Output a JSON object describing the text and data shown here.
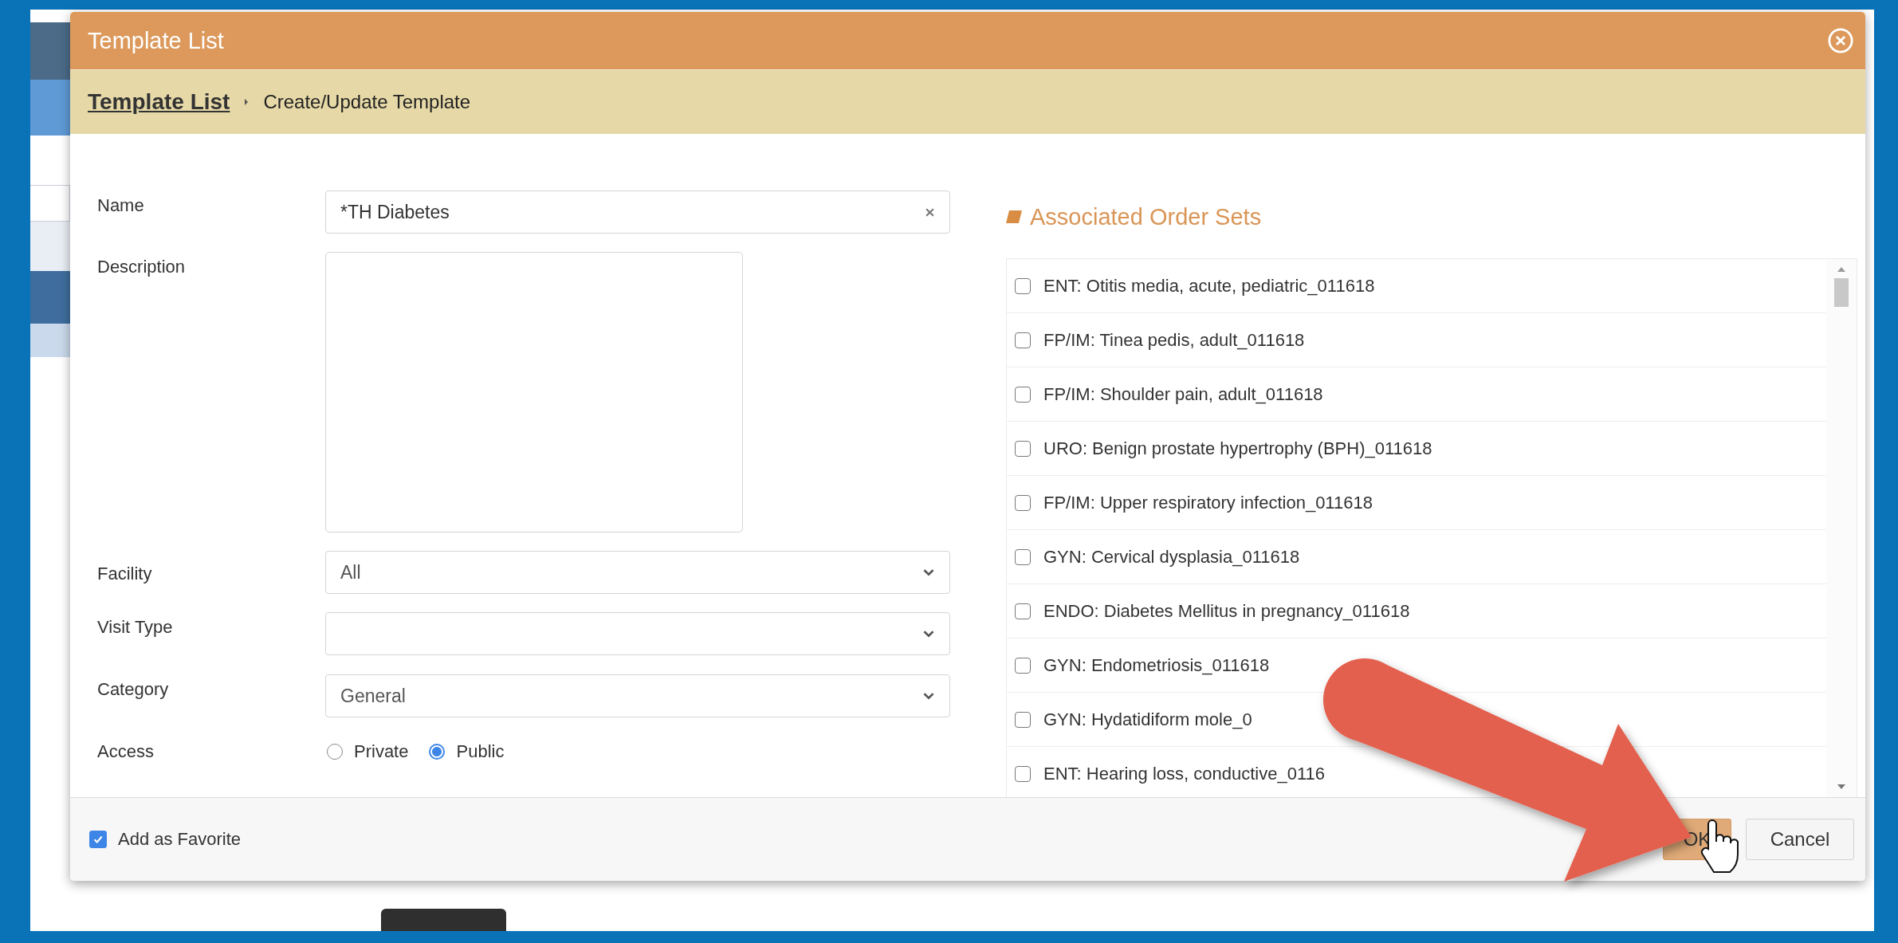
{
  "window": {
    "title": "Template List"
  },
  "breadcrumb": [
    {
      "label": "Template List",
      "kind": "link"
    },
    {
      "label": "Create/Update Template",
      "kind": "current"
    }
  ],
  "form": [
    {
      "kind": "text",
      "label": "Name",
      "value": "*TH Diabetes"
    },
    {
      "kind": "textarea",
      "label": "Description"
    },
    {
      "kind": "select",
      "label": "Facility",
      "value": "All"
    },
    {
      "kind": "select",
      "label": "Visit Type"
    },
    {
      "kind": "select",
      "label": "Category",
      "value": "General"
    },
    {
      "kind": "radio",
      "label": "Access",
      "options": [
        {
          "label": "Private",
          "selected": false
        },
        {
          "label": "Public",
          "selected": true
        }
      ]
    }
  ],
  "order_sets": {
    "title": "Associated Order Sets",
    "items": [
      {
        "label": "ENT: Otitis media, acute, pediatric_011618",
        "checked": false
      },
      {
        "label": "FP/IM: Tinea pedis, adult_011618",
        "checked": false
      },
      {
        "label": "FP/IM: Shoulder pain, adult_011618",
        "checked": false
      },
      {
        "label": "URO: Benign prostate hypertrophy (BPH)_011618",
        "checked": false
      },
      {
        "label": "FP/IM: Upper respiratory infection_011618",
        "checked": false
      },
      {
        "label": "GYN: Cervical dysplasia_011618",
        "checked": false
      },
      {
        "label": "ENDO: Diabetes Mellitus in pregnancy_011618",
        "checked": false
      },
      {
        "label": "GYN: Endometriosis_011618",
        "checked": false
      },
      {
        "label": "GYN: Hydatidiform mole_0",
        "checked": false
      },
      {
        "label": "ENT: Hearing loss, conductive_0116",
        "checked": false
      }
    ]
  },
  "footer": {
    "favorite": {
      "label": "Add as Favorite",
      "checked": true
    },
    "buttons": [
      {
        "label": "OK",
        "kind": "primary"
      },
      {
        "label": "Cancel",
        "kind": "secondary"
      }
    ]
  }
}
